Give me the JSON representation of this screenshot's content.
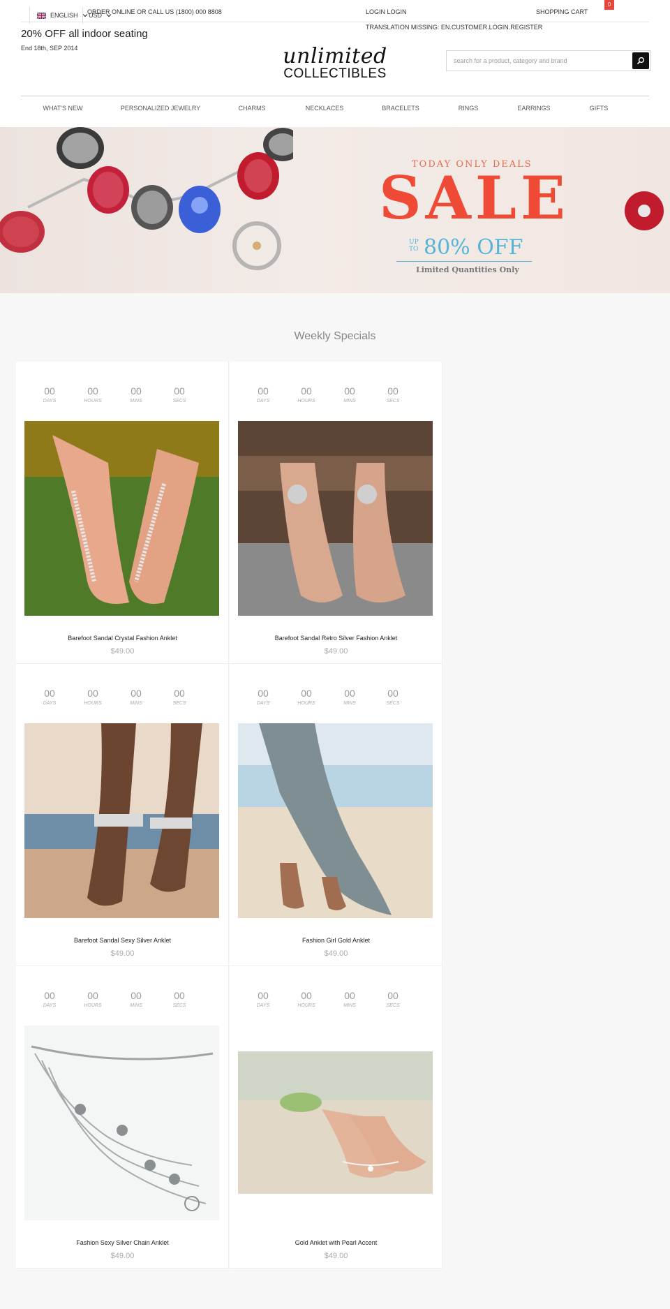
{
  "topbar": {
    "language": "ENGLISH",
    "currency": "USD",
    "order_line": "ORDER ONLINE OR CALL US (1800) 000 8808",
    "login": "LOGIN LOGIN",
    "cart": "SHOPPING CART",
    "cart_count": "0",
    "register": "TRANSLATION MISSING: EN.CUSTOMER.LOGIN.REGISTER"
  },
  "promo": {
    "title": "20% OFF all indoor seating",
    "date": "End 18th, SEP 2014"
  },
  "logo": {
    "script": "unlimited",
    "caps": "COLLECTIBLES"
  },
  "search": {
    "placeholder": "search for a product, category and brand",
    "icon": "search-icon"
  },
  "nav": {
    "items": [
      "WHAT'S NEW",
      "PERSONALIZED JEWELRY",
      "CHARMS",
      "NECKLACES",
      "BRACELETS",
      "RINGS",
      "EARRINGS",
      "GIFTS"
    ]
  },
  "banner": {
    "top": "TODAY ONLY DEALS",
    "sale": "SALE",
    "upto_1": "UP",
    "upto_2": "TO",
    "off": "80% OFF",
    "limited": "Limited Quantities Only"
  },
  "specials": {
    "title": "Weekly Specials",
    "countdown_labels": [
      "DAYS",
      "HOURS",
      "MINS",
      "SECS"
    ],
    "products": [
      {
        "name": "Barefoot Sandal Crystal Fashion Anklet",
        "price": "$49.00",
        "countdown": [
          "00",
          "00",
          "00",
          "00"
        ]
      },
      {
        "name": "Barefoot Sandal Retro Silver Fashion Anklet",
        "price": "$49.00",
        "countdown": [
          "00",
          "00",
          "00",
          "00"
        ]
      },
      {
        "name": "Barefoot Sandal Sexy Silver Anklet",
        "price": "$49.00",
        "countdown": [
          "00",
          "00",
          "00",
          "00"
        ]
      },
      {
        "name": "Fashion Girl Gold Anklet",
        "price": "$49.00",
        "countdown": [
          "00",
          "00",
          "00",
          "00"
        ]
      },
      {
        "name": "Fashion Sexy Silver Chain Anklet",
        "price": "$49.00",
        "countdown": [
          "00",
          "00",
          "00",
          "00"
        ]
      },
      {
        "name": "Gold Anklet with Pearl Accent",
        "price": "$49.00",
        "countdown": [
          "00",
          "00",
          "00",
          "00"
        ]
      }
    ]
  },
  "colors": {
    "accent": "#e8453c",
    "sale_red": "#ef4a35",
    "off_blue": "#56b4d6",
    "page_bg": "#f7f7f7"
  }
}
